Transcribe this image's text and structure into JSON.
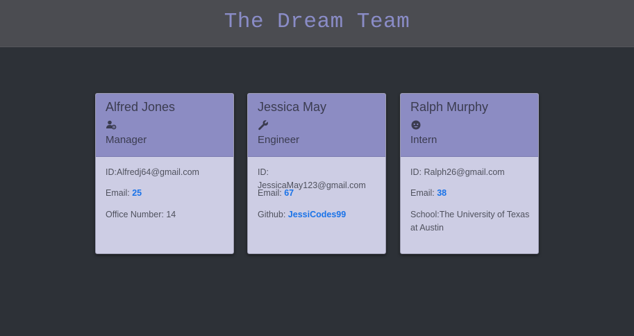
{
  "header": {
    "title": "The Dream Team"
  },
  "cards": [
    {
      "name": "Alfred Jones",
      "icon": "manager-icon",
      "role": "Manager",
      "id_label": "ID:",
      "id_value": "Alfredj64@gmail.com",
      "email_label": "Email:",
      "email_value": "25",
      "extra_label": "Office Number:",
      "extra_value": "14"
    },
    {
      "name": "Jessica May",
      "icon": "wrench-icon",
      "role": "Engineer",
      "id_label": "ID:",
      "id_value": "JessicaMay123@gmail.com",
      "email_label": "Email:",
      "email_value": "67",
      "extra_label": "Github:",
      "extra_value": "JessiCodes99"
    },
    {
      "name": "Ralph Murphy",
      "icon": "student-icon",
      "role": "Intern",
      "id_label": "ID:",
      "id_value": "Ralph26@gmail.com",
      "email_label": "Email:",
      "email_value": "38",
      "extra_label": "School:",
      "extra_value": "The University of Texas at Austin"
    }
  ],
  "colors": {
    "background": "#2d3137",
    "header": "#4b4c51",
    "title": "#8a8cc7",
    "card_head": "#8c8cc3",
    "card_body": "#cdcde4",
    "link": "#1a73e8"
  }
}
